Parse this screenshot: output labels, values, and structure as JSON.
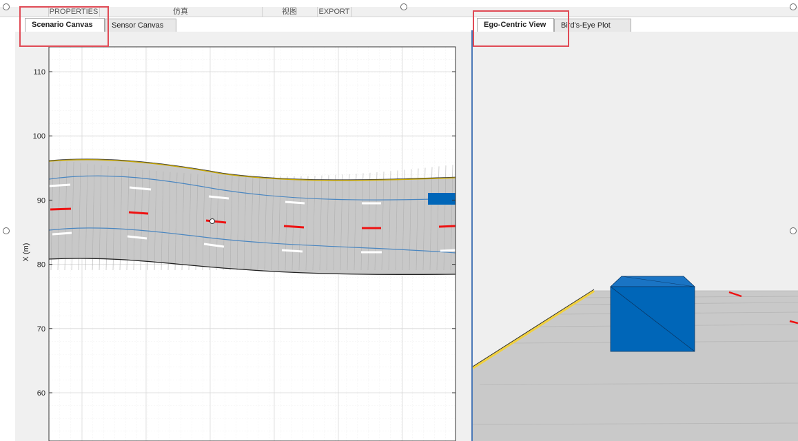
{
  "toolstrip": {
    "properties": "PROPERTIES",
    "simulate": "仿真",
    "view": "视图",
    "export": "EXPORT"
  },
  "left_tabs": {
    "scenario_canvas": "Scenario Canvas",
    "sensor_canvas": "Sensor Canvas"
  },
  "right_tabs": {
    "ego_centric_view": "Ego-Centric View",
    "birds_eye_plot": "Bird's-Eye Plot"
  },
  "scenario_canvas": {
    "ylabel": "X (m)",
    "yticks": [
      "110",
      "100",
      "90",
      "80",
      "70",
      "60"
    ],
    "colors": {
      "road": "#c8c8c8",
      "lane_center": "#4a86c0",
      "dashed_white": "#ffffff",
      "dashed_red": "#ee1111",
      "road_edge_yellow": "#c8a800",
      "vehicle": "#0066b8"
    }
  },
  "ego_view": {
    "colors": {
      "background": "#efefef",
      "road": "#c9c9c9",
      "edge_yellow": "#f0d040",
      "vehicle": "#0066b8"
    }
  }
}
